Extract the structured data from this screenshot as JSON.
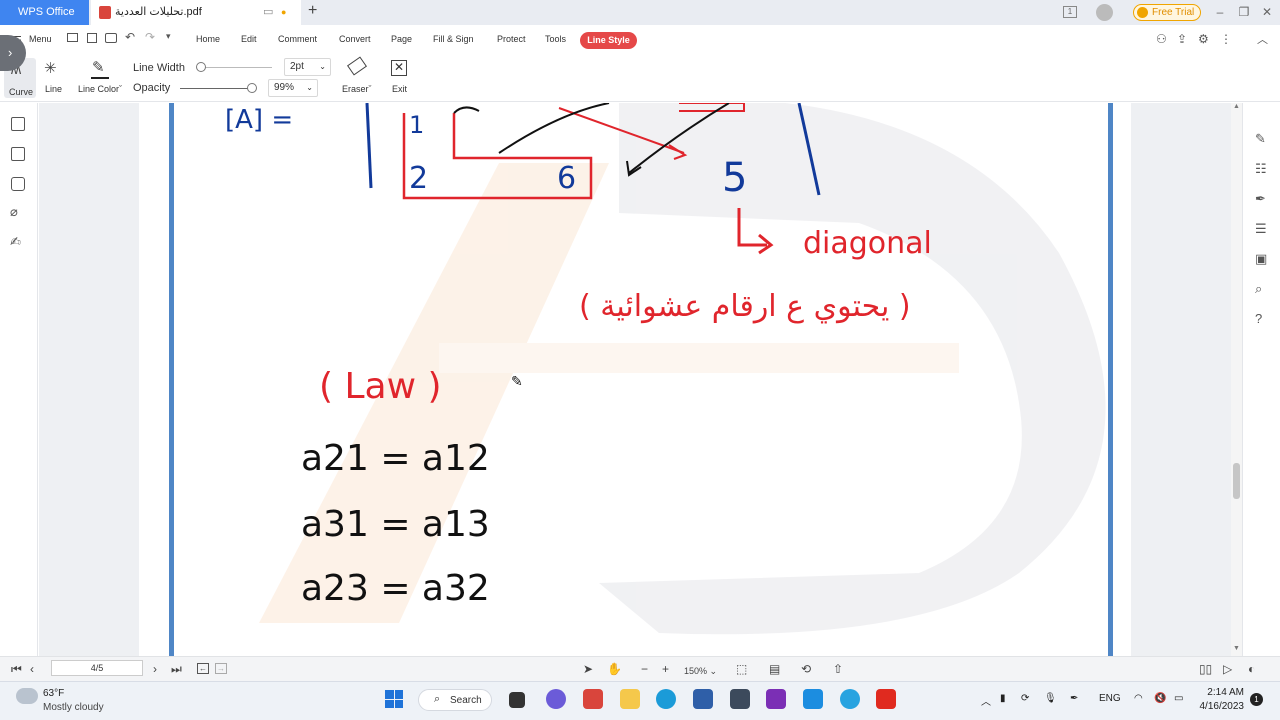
{
  "titlebar": {
    "app_tab": "WPS Office",
    "doc_tab": "تحليلات العددية.pdf",
    "new_tab": "+",
    "free_trial": "Free Trial"
  },
  "menubar": {
    "menu_label": "Menu",
    "items": [
      "Home",
      "Edit",
      "Comment",
      "Convert",
      "Page",
      "Fill & Sign",
      "Protect",
      "Tools"
    ],
    "active": "Line Style"
  },
  "ribbon": {
    "curve": "Curve",
    "line": "Line",
    "line_color": "Line Color",
    "line_width_label": "Line Width",
    "line_width_value": "2pt",
    "opacity_label": "Opacity",
    "opacity_value": "99%",
    "eraser": "Eraser",
    "exit": "Exit"
  },
  "document": {
    "top_bracket": "[A] =",
    "matrix_digits": [
      "1",
      "2",
      "6",
      "5"
    ],
    "diagonal_note": "diagonal",
    "arabic_note": "( يحتوي ع ارقام عشوائية )",
    "law_title": "( Law )",
    "equations": [
      "a21 = a12",
      "a31 = a13",
      "a23 = a32"
    ]
  },
  "statusbar": {
    "page": "4/5",
    "zoom": "150%"
  },
  "taskbar": {
    "weather_temp": "63°F",
    "weather_desc": "Mostly cloudy",
    "search": "Search",
    "lang": "ENG",
    "time": "2:14 AM",
    "date": "4/16/2023",
    "notif_count": "1"
  },
  "colors": {
    "accent_blue": "#3f85f0",
    "active_red": "#e54848",
    "ink_blue": "#123a9a",
    "ink_red": "#e0252c",
    "ink_black": "#111111",
    "page_border": "#4f86c6"
  }
}
